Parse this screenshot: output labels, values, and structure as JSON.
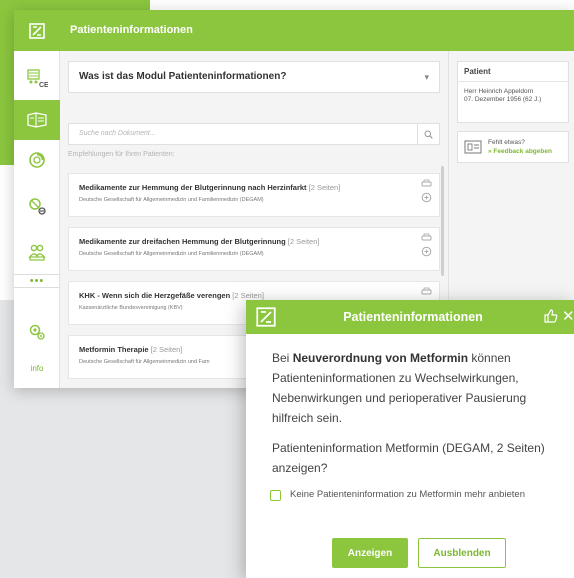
{
  "colors": {
    "accent": "#8cc63f",
    "accent_dark": "#7cb82f",
    "background_gray": "#e4e6e8"
  },
  "header": {
    "title": "Patienteninformationen"
  },
  "sidebar": {
    "items": [
      {
        "icon": "cart-ce-icon"
      },
      {
        "icon": "info-leaflet-icon",
        "active": true
      },
      {
        "icon": "pill-icon"
      },
      {
        "icon": "therapy-icon"
      },
      {
        "icon": "people-icon"
      },
      {
        "icon": "more-icon",
        "label": "•••"
      },
      {
        "icon": "settings-icon"
      }
    ],
    "info_label": "info"
  },
  "module": {
    "label": "Was ist das Modul Patienteninformationen?"
  },
  "search": {
    "placeholder": "Suche nach Dokument..."
  },
  "recommendations_label": "Empfehlungen für Ihren Patienten:",
  "documents": [
    {
      "title": "Medikamente zur Hemmung der Blutgerinnung nach Herzinfarkt",
      "pages": "[2 Seiten]",
      "source": "Deutsche Gesellschaft für Allgemeinmedizin und Familienmedizin (DEGAM)"
    },
    {
      "title": "Medikamente zur dreifachen Hemmung der Blutgerinnung",
      "pages": "[2 Seiten]",
      "source": "Deutsche Gesellschaft für Allgemeinmedizin und Familienmedizin (DEGAM)"
    },
    {
      "title": "KHK - Wenn sich die Herzgefäße verengen",
      "pages": "[2 Seiten]",
      "source": "Kassenärztliche Bundesvereinigung (KBV)"
    },
    {
      "title": "Metformin Therapie",
      "pages": "[2 Seiten]",
      "source": "Deutsche Gesellschaft für Allgemeinmedizin und Fam"
    }
  ],
  "patient": {
    "heading": "Patient",
    "name": "Herr Heinrich Appeldorn",
    "dob": "07. Dezember 1956 (62 J.)"
  },
  "feedback": {
    "question": "Fehlt etwas?",
    "link": "» Feedback abgeben"
  },
  "popup": {
    "title": "Patienteninformationen",
    "text_prefix": "Bei ",
    "text_bold": "Neuverordnung von Metformin",
    "text_suffix": " können Patienteninformationen zu Wechselwirkungen, Nebenwirkungen und perioperativer Pausierung hilfreich sein.",
    "question": "Patienteninformation Metformin (DEGAM, 2 Seiten) anzeigen?",
    "checkbox_label": "Keine Patienteninformation zu Metformin mehr anbieten",
    "show_button": "Anzeigen",
    "hide_button": "Ausblenden"
  }
}
